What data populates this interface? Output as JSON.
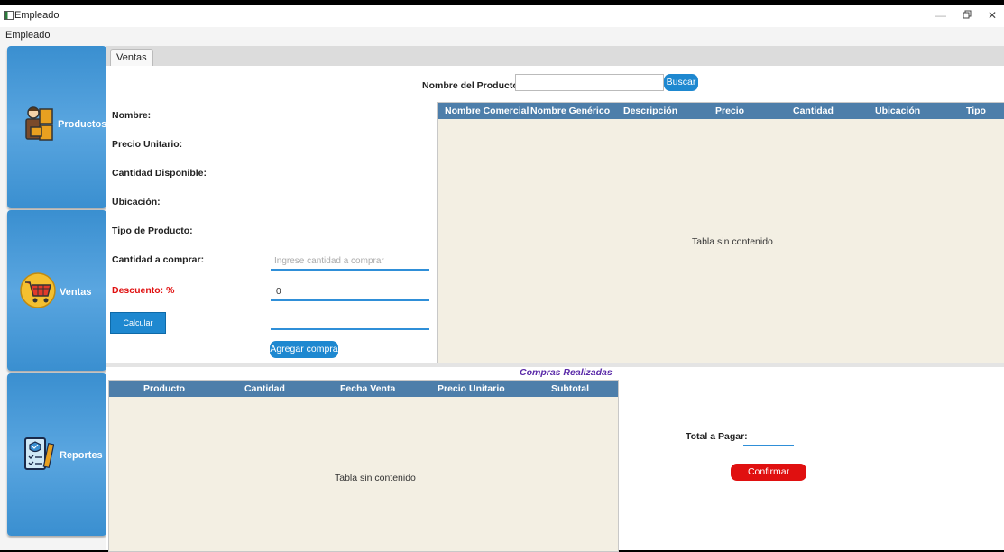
{
  "window": {
    "title": "Empleado",
    "restore_icon": "restore-icon",
    "close_icon": "close-icon",
    "minimize_icon": "minimize-icon"
  },
  "menu": {
    "items": [
      "Empleado"
    ]
  },
  "sidebar": {
    "items": [
      {
        "label": "Productos",
        "icon": "products-icon"
      },
      {
        "label": "Ventas",
        "icon": "cart-icon"
      },
      {
        "label": "Reportes",
        "icon": "report-icon"
      }
    ]
  },
  "tabs": [
    "Ventas"
  ],
  "search": {
    "label": "Nombre del Producto:",
    "value": "",
    "button": "Buscar"
  },
  "form": {
    "nombre": "Nombre:",
    "precio_unitario": "Precio Unitario:",
    "cantidad_disponible": "Cantidad Disponible:",
    "ubicacion": "Ubicación:",
    "tipo": "Tipo de Producto:",
    "cantidad_comprar": "Cantidad a comprar:",
    "cantidad_placeholder": "Ingrese cantidad a comprar",
    "descuento": "Descuento:  %",
    "descuento_value": "0",
    "calcular_button": "Calcular Precio",
    "precio_value": "",
    "agregar_button": "Agregar compra"
  },
  "products_table": {
    "columns": [
      "Nombre Comercial",
      "Nombre Genérico",
      "Descripción",
      "Precio",
      "Cantidad",
      "Ubicación",
      "Tipo"
    ],
    "empty": "Tabla sin contenido"
  },
  "purchases": {
    "title": "Compras Realizadas",
    "columns": [
      "Producto",
      "Cantidad",
      "Fecha Venta",
      "Precio Unitario",
      "Subtotal"
    ],
    "empty": "Tabla sin contenido"
  },
  "total": {
    "label": "Total a Pagar:",
    "value": "",
    "confirm_button": "Confirmar Compra"
  },
  "colors": {
    "accent": "#1e88d0",
    "header": "#4d7eaa",
    "danger": "#e01010",
    "purple_title": "#5a2aa8",
    "table_bg": "#f3efe3"
  }
}
